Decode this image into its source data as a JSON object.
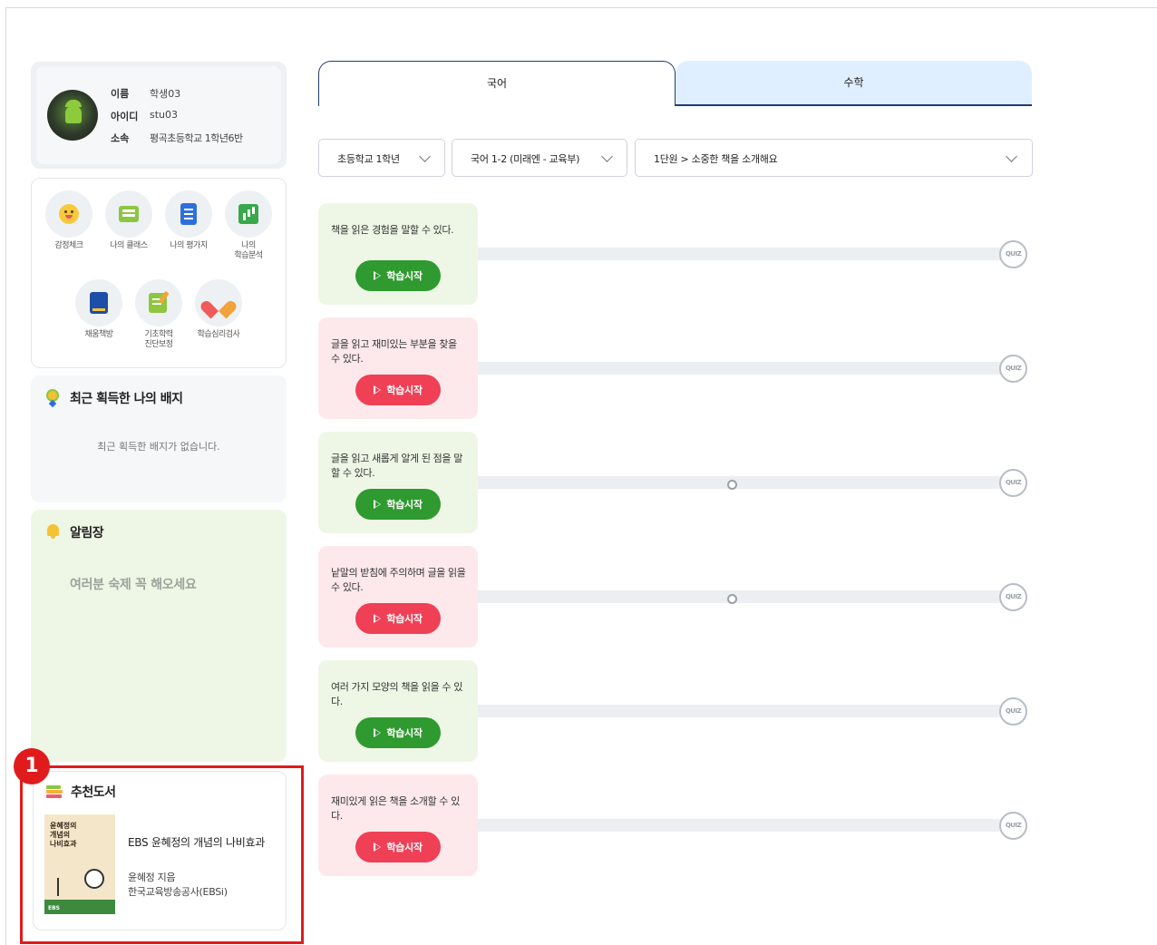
{
  "profile": {
    "name_label": "이름",
    "name": "학생03",
    "id_label": "아이디",
    "id": "stu03",
    "org_label": "소속",
    "org": "평곡초등학교 1학년6반"
  },
  "menu": {
    "items": [
      {
        "label": "감정체크",
        "icon": "emotion-check-icon"
      },
      {
        "label": "나의 클래스",
        "icon": "my-class-icon"
      },
      {
        "label": "나의 평가지",
        "icon": "my-evaluation-icon"
      },
      {
        "label": "나의\n학습분석",
        "icon": "learning-analysis-icon"
      },
      {
        "label": "채움책방",
        "icon": "book-icon"
      },
      {
        "label": "기초학력\n진단보정",
        "icon": "diagnosis-icon"
      },
      {
        "label": "학습심리검사",
        "icon": "heart-icon"
      }
    ]
  },
  "badges": {
    "title": "최근 획득한 나의 배지",
    "empty": "최근 획득한 배지가 없습니다."
  },
  "notice": {
    "title": "알림장",
    "text": "여러분 숙제 꼭 해오세요"
  },
  "books": {
    "title": "추천도서",
    "cover_text": "윤혜정의\n개념의\n나비효과",
    "cover_publisher": "EBS",
    "book_title": "EBS 윤혜정의 개념의 나비효과",
    "author": "윤혜정 지음",
    "publisher": "한국교육방송공사(EBSi)"
  },
  "annotation": {
    "marker": "1"
  },
  "tabs": [
    {
      "label": "국어",
      "active": true
    },
    {
      "label": "수학",
      "active": false
    }
  ],
  "filters": {
    "grade": "초등학교 1학년",
    "textbook": "국어 1-2 (미래엔 - 교육부)",
    "unit": "1단원 > 소중한 책을 소개해요"
  },
  "lessons": [
    {
      "text": "책을 읽은 경험을 말할 수 있다.",
      "color": "green",
      "progress_marker": false
    },
    {
      "text": "글을 읽고 재미있는 부분을 찾을 수 있다.",
      "color": "pink",
      "progress_marker": false
    },
    {
      "text": "글을 읽고 새롭게 알게 된 점을 말할 수 있다.",
      "color": "green",
      "progress_marker": true
    },
    {
      "text": "낱말의 받침에 주의하며 글을 읽을 수 있다.",
      "color": "pink",
      "progress_marker": true
    },
    {
      "text": "여러 가지 모양의 책을 읽을 수 있다.",
      "color": "green",
      "progress_marker": false
    },
    {
      "text": "재미있게 읽은 책을 소개할 수 있다.",
      "color": "pink",
      "progress_marker": false
    }
  ],
  "start_label": "학습시작",
  "quiz_label": "QUIZ",
  "colors": {
    "green_button": "#2f9a2f",
    "red_button": "#ef4056",
    "tab_border": "#1f3d70",
    "highlight": "#e01b1b"
  }
}
